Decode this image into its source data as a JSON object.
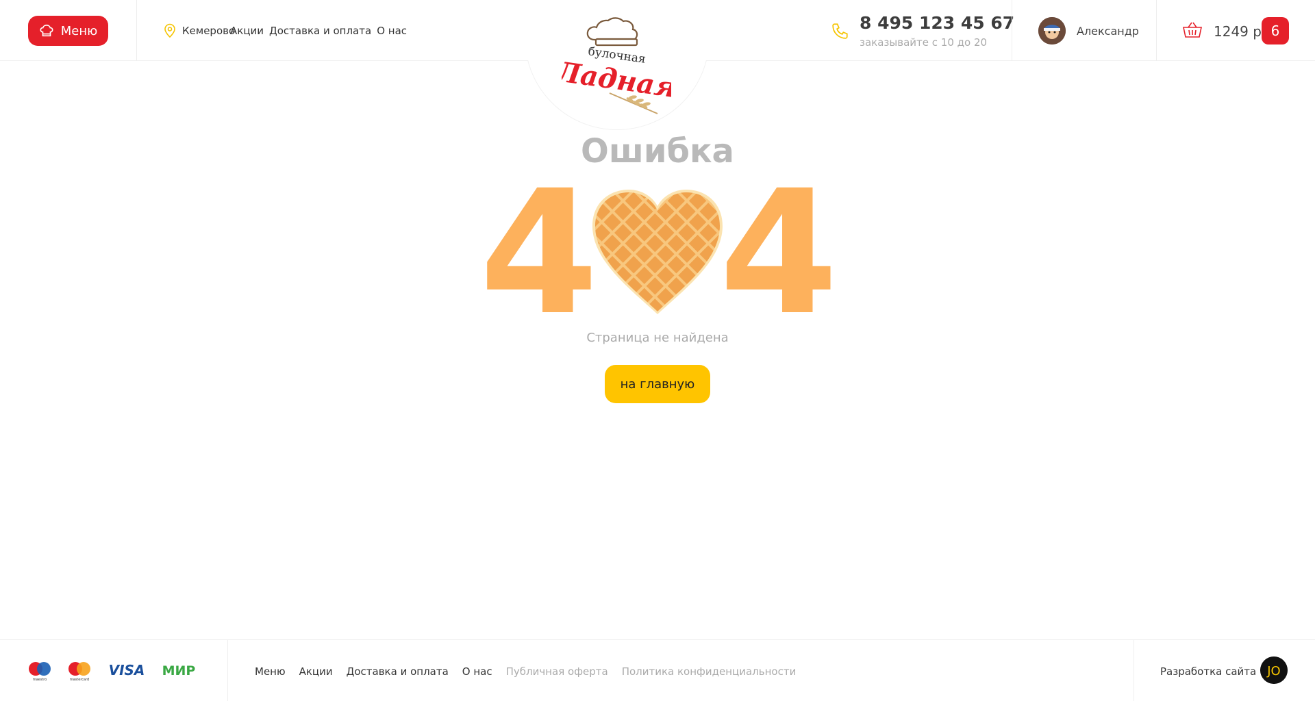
{
  "header": {
    "menu_label": "Меню",
    "city": "Кемерово",
    "nav": [
      "Акции",
      "Доставка и оплата",
      "О нас"
    ],
    "logo_text_top": "булочная",
    "logo_text_main": "Ладная",
    "phone": "8 495 123 45 67",
    "phone_hours": "заказывайте с 10 до 20",
    "username": "Александр",
    "basket_sum": "1249 р",
    "basket_count": "6"
  },
  "main": {
    "title": "Ошибка",
    "code_left": "4",
    "code_right": "4",
    "subtitle": "Страница не найдена",
    "home_button": "на главную"
  },
  "footer": {
    "payments": [
      "maestro",
      "mastercard",
      "VISA",
      "МИР"
    ],
    "nav": [
      "Меню",
      "Акции",
      "Доставка и оплата",
      "О нас"
    ],
    "nav_muted": [
      "Публичная оферта",
      "Политика конфиденциальности"
    ],
    "dev_label": "Разработка сайта",
    "dev_logo": "JO"
  },
  "colors": {
    "accent_red": "#e5202a",
    "accent_yellow": "#ffc400",
    "digit_orange": "#fdb15c",
    "waffle": "#f0a24c"
  }
}
